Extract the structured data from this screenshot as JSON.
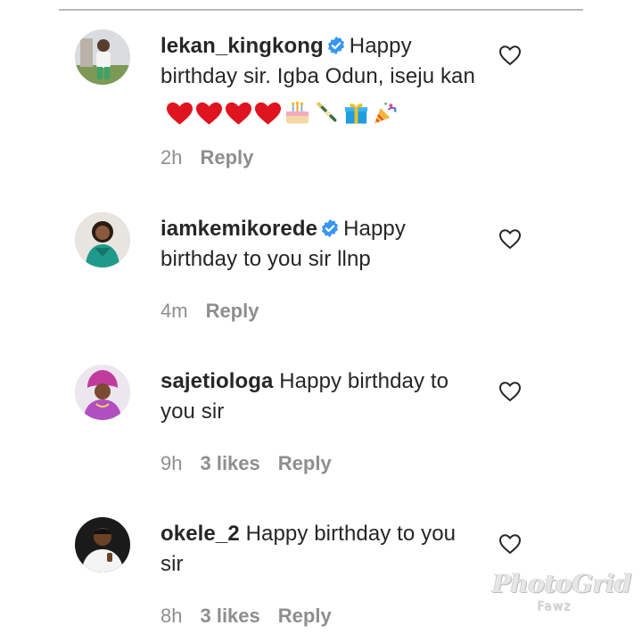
{
  "comments": [
    {
      "username": "lekan_kingkong",
      "verified": true,
      "text": "Happy birthday sir. Igba Odun, iseju kan",
      "emojis": [
        "red-heart",
        "red-heart",
        "red-heart",
        "red-heart",
        "birthday-cake",
        "champagne-bottle",
        "gift",
        "party-popper"
      ],
      "time": "2h",
      "likes": "",
      "reply": "Reply"
    },
    {
      "username": "iamkemikorede",
      "verified": true,
      "text": "Happy birthday to you sir llnp",
      "time": "4m",
      "likes": "",
      "reply": "Reply"
    },
    {
      "username": "sajetiologa",
      "verified": false,
      "text": "Happy birthday to you sir",
      "time": "9h",
      "likes": "3 likes",
      "reply": "Reply"
    },
    {
      "username": "okele_2",
      "verified": false,
      "text": "Happy birthday to you sir",
      "time": "8h",
      "likes": "3 likes",
      "reply": "Reply"
    }
  ],
  "watermark": {
    "brand": "PhotoGrid",
    "sub": "Fawz"
  },
  "colors": {
    "text": "#262626",
    "secondary": "#8e8e8e",
    "verified": "#3897f0",
    "heart": "#ed1c24"
  }
}
